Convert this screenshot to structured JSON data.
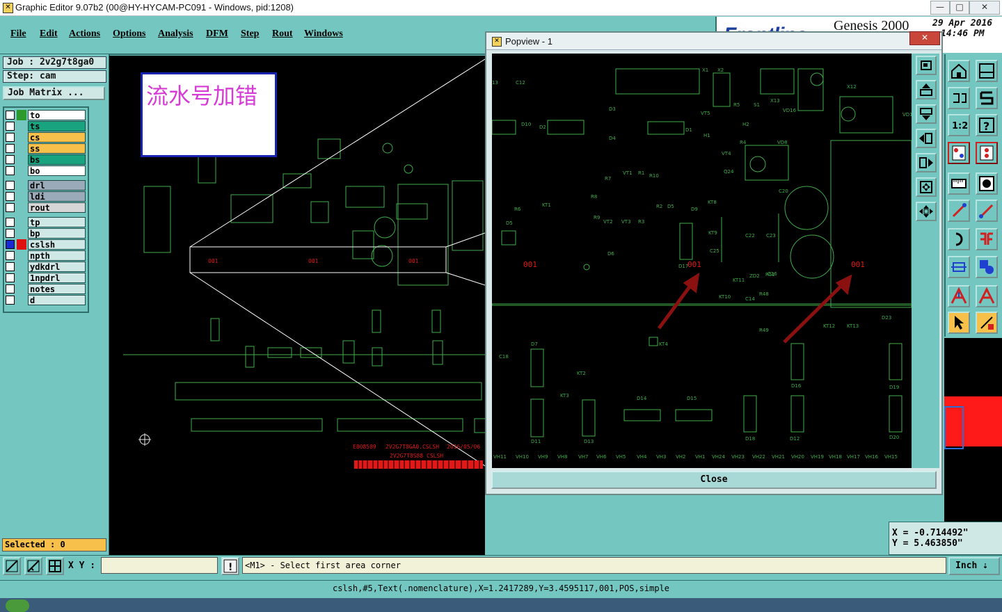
{
  "window": {
    "title": "Graphic Editor 9.07b2 (00@HY-HYCAM-PC091 - Windows, pid:1208)",
    "minimize": "—",
    "maximize": "□",
    "close": "✕"
  },
  "menu": [
    "File",
    "Edit",
    "Actions",
    "Options",
    "Analysis",
    "DFM",
    "Step",
    "Rout",
    "Windows"
  ],
  "brand": {
    "logo": "Frontline",
    "product": "Genesis 2000",
    "date": "29 Apr 2016",
    "time": "14:46 PM"
  },
  "job": {
    "label": "Job : 2v2g7t8ga0",
    "step": "Step: cam",
    "matrix_button": "Job Matrix ..."
  },
  "layers_group1": [
    {
      "name": "to",
      "color": "#ffffff",
      "swatch": "#2e9a2e"
    },
    {
      "name": "ts",
      "color": "#1aa37f"
    },
    {
      "name": "cs",
      "color": "#f7c04a"
    },
    {
      "name": "ss",
      "color": "#f7c04a"
    },
    {
      "name": "bs",
      "color": "#1aa37f"
    },
    {
      "name": "bo",
      "color": "#ffffff"
    }
  ],
  "layers_group2": [
    {
      "name": "drl",
      "color": "#9aaab8"
    },
    {
      "name": "ldi",
      "color": "#9aaab8"
    },
    {
      "name": "rout",
      "color": "#d6d6d6"
    }
  ],
  "layers_group3": [
    {
      "name": "tp",
      "color": "#cfe8e6"
    },
    {
      "name": "bp",
      "color": "#cfe8e6"
    },
    {
      "name": "cslsh",
      "color": "#cfe8e6",
      "swatch": "#e01010",
      "active": true
    },
    {
      "name": "npth",
      "color": "#cfe8e6"
    },
    {
      "name": "ydkdrl",
      "color": "#cfe8e6"
    },
    {
      "name": "1npdrl",
      "color": "#cfe8e6"
    },
    {
      "name": "notes",
      "color": "#cfe8e6"
    },
    {
      "name": "d",
      "color": "#cfe8e6"
    }
  ],
  "selected": "Selected : 0",
  "annotation": "流水号加错",
  "canvas_labels": {
    "sn1": "001",
    "sn2": "001",
    "sn3": "001",
    "footer1": "E808589",
    "footer2": "2V2G7T8GA0.CSLSH",
    "footer3": "2016/05/06",
    "footer4": "2V2G7T8S88 CSLSH"
  },
  "popview": {
    "title": "Popview - 1",
    "close_button": "Close",
    "labels_red": [
      "001",
      "001",
      "001"
    ],
    "component_labels": [
      "X1",
      "X2",
      "X12",
      "X13",
      "C12",
      "D10",
      "D2",
      "D3",
      "D1",
      "D4",
      "R5",
      "S1",
      "VT5",
      "H1",
      "H2",
      "VD16",
      "VD8",
      "R4",
      "VT4",
      "Q24",
      "VT1",
      "R1",
      "R10",
      "R7",
      "R8",
      "R9",
      "VT2",
      "VT3",
      "R3",
      "R2",
      "D5",
      "D9",
      "KT8",
      "R6",
      "KT1",
      "D6",
      "D17",
      "KT9",
      "C22",
      "C23",
      "C25",
      "C20",
      "KT11",
      "R51",
      "C16",
      "C19",
      "ZD2",
      "KT10",
      "C14",
      "R48",
      "R49",
      "KT12",
      "KT13",
      "D23",
      "D7",
      "C18",
      "KT2",
      "KT3",
      "KT4",
      "D11",
      "D13",
      "D14",
      "D15",
      "D18",
      "D12",
      "D16",
      "D19",
      "D20",
      "VH11",
      "VH10",
      "VH9",
      "VH8",
      "VH7",
      "VH6",
      "VH5",
      "VH4",
      "VH3",
      "VH2",
      "VH1",
      "VH24",
      "VH23",
      "VH22",
      "VH21",
      "VH20",
      "VH19",
      "VH18",
      "VH17",
      "VH16",
      "VH15"
    ]
  },
  "coords": {
    "x": "X = -0.714492\"",
    "y": "Y = 5.463850\""
  },
  "bottom": {
    "xy_label": "X Y :",
    "xy_value": "",
    "prompt": "<M1> - Select first area corner",
    "units": "Inch",
    "status": "cslsh,#5,Text(.nomenclature),X=1.2417289,Y=3.4595117,001,POS,simple"
  },
  "colors": {
    "teal": "#74c7c1",
    "green_lines": "#3fae4a",
    "red_text": "#e01818",
    "arrow": "#8b1010"
  }
}
